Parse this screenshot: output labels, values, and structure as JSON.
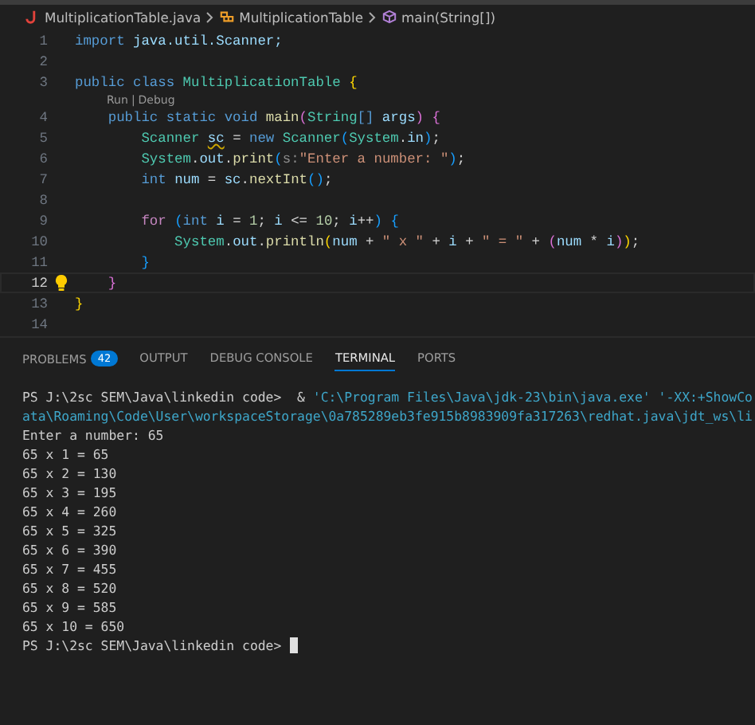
{
  "breadcrumb": [
    {
      "kind": "file",
      "label": "MultiplicationTable.java"
    },
    {
      "kind": "class",
      "label": "MultiplicationTable"
    },
    {
      "kind": "method",
      "label": "main(String[])"
    }
  ],
  "editor": {
    "lines": [
      {
        "kind": "code",
        "number": "1",
        "current": false,
        "tokens": [
          {
            "text": "import",
            "kind": "kw"
          },
          {
            "text": " java.util.Scanner;",
            "kind": "var"
          }
        ]
      },
      {
        "kind": "code",
        "number": "2",
        "current": false
      },
      {
        "kind": "code",
        "number": "3",
        "current": false,
        "tokens": [
          {
            "text": "public class ",
            "kind": "kw"
          },
          {
            "text": "MultiplicationTable ",
            "kind": "type"
          },
          {
            "text": "{",
            "kind": "b1"
          }
        ]
      },
      {
        "kind": "codelens",
        "links": [
          "Run",
          "Debug"
        ],
        "separator": "|"
      },
      {
        "kind": "code",
        "number": "4",
        "current": false,
        "tokens": [
          {
            "text": "    public static void ",
            "kind": "kw"
          },
          {
            "text": "main",
            "kind": "func"
          },
          {
            "text": "(",
            "kind": "b2"
          },
          {
            "text": "String",
            "kind": "type"
          },
          {
            "text": "[]",
            "kind": "kw"
          },
          {
            "text": " args",
            "kind": "var"
          },
          {
            "text": ") ",
            "kind": "b2"
          },
          {
            "text": "{",
            "kind": "b2"
          }
        ]
      },
      {
        "kind": "code",
        "number": "5",
        "current": false,
        "tokens": [
          {
            "text": "        Scanner ",
            "kind": "type"
          },
          {
            "text": "sc",
            "kind": "var",
            "warning": true
          },
          {
            "text": " = ",
            "kind": "plain"
          },
          {
            "text": "new ",
            "kind": "kw"
          },
          {
            "text": "Scanner",
            "kind": "type"
          },
          {
            "text": "(",
            "kind": "b3"
          },
          {
            "text": "System",
            "kind": "type"
          },
          {
            "text": ".",
            "kind": "plain"
          },
          {
            "text": "in",
            "kind": "var"
          },
          {
            "text": ")",
            "kind": "b3"
          },
          {
            "text": ";",
            "kind": "plain"
          }
        ]
      },
      {
        "kind": "code",
        "number": "6",
        "current": false,
        "tokens": [
          {
            "text": "        System",
            "kind": "type"
          },
          {
            "text": ".",
            "kind": "plain"
          },
          {
            "text": "out",
            "kind": "var"
          },
          {
            "text": ".",
            "kind": "plain"
          },
          {
            "text": "print",
            "kind": "func"
          },
          {
            "text": "(",
            "kind": "b3"
          },
          {
            "text": "s:",
            "kind": "hint"
          },
          {
            "text": "\"Enter a number: \"",
            "kind": "string"
          },
          {
            "text": ")",
            "kind": "b3"
          },
          {
            "text": ";",
            "kind": "plain"
          }
        ]
      },
      {
        "kind": "code",
        "number": "7",
        "current": false,
        "tokens": [
          {
            "text": "        int ",
            "kind": "kw"
          },
          {
            "text": "num",
            "kind": "var"
          },
          {
            "text": " = ",
            "kind": "plain"
          },
          {
            "text": "sc",
            "kind": "var"
          },
          {
            "text": ".",
            "kind": "plain"
          },
          {
            "text": "nextInt",
            "kind": "func"
          },
          {
            "text": "()",
            "kind": "b3"
          },
          {
            "text": ";",
            "kind": "plain"
          }
        ]
      },
      {
        "kind": "code",
        "number": "8",
        "current": false
      },
      {
        "kind": "code",
        "number": "9",
        "current": false,
        "tokens": [
          {
            "text": "        for ",
            "kind": "ctrl"
          },
          {
            "text": "(",
            "kind": "b3"
          },
          {
            "text": "int ",
            "kind": "kw"
          },
          {
            "text": "i",
            "kind": "var"
          },
          {
            "text": " = ",
            "kind": "plain"
          },
          {
            "text": "1",
            "kind": "num"
          },
          {
            "text": "; ",
            "kind": "plain"
          },
          {
            "text": "i",
            "kind": "var"
          },
          {
            "text": " <= ",
            "kind": "plain"
          },
          {
            "text": "10",
            "kind": "num"
          },
          {
            "text": "; ",
            "kind": "plain"
          },
          {
            "text": "i",
            "kind": "var"
          },
          {
            "text": "++",
            "kind": "plain"
          },
          {
            "text": ") ",
            "kind": "b3"
          },
          {
            "text": "{",
            "kind": "b3"
          }
        ]
      },
      {
        "kind": "code",
        "number": "10",
        "current": false,
        "tokens": [
          {
            "text": "            System",
            "kind": "type"
          },
          {
            "text": ".",
            "kind": "plain"
          },
          {
            "text": "out",
            "kind": "var"
          },
          {
            "text": ".",
            "kind": "plain"
          },
          {
            "text": "println",
            "kind": "func"
          },
          {
            "text": "(",
            "kind": "b1"
          },
          {
            "text": "num",
            "kind": "var"
          },
          {
            "text": " + ",
            "kind": "plain"
          },
          {
            "text": "\" x \"",
            "kind": "string"
          },
          {
            "text": " + ",
            "kind": "plain"
          },
          {
            "text": "i",
            "kind": "var"
          },
          {
            "text": " + ",
            "kind": "plain"
          },
          {
            "text": "\" = \"",
            "kind": "string"
          },
          {
            "text": " + ",
            "kind": "plain"
          },
          {
            "text": "(",
            "kind": "b2"
          },
          {
            "text": "num",
            "kind": "var"
          },
          {
            "text": " * ",
            "kind": "plain"
          },
          {
            "text": "i",
            "kind": "var"
          },
          {
            "text": ")",
            "kind": "b2"
          },
          {
            "text": ")",
            "kind": "b1"
          },
          {
            "text": ";",
            "kind": "plain"
          }
        ]
      },
      {
        "kind": "code",
        "number": "11",
        "current": false,
        "tokens": [
          {
            "text": "        }",
            "kind": "b3"
          }
        ]
      },
      {
        "kind": "code",
        "number": "12",
        "current": true,
        "lightbulb": true,
        "tokens": [
          {
            "text": "    }",
            "kind": "b2"
          }
        ]
      },
      {
        "kind": "code",
        "number": "13",
        "current": false,
        "tokens": [
          {
            "text": "}",
            "kind": "b1"
          }
        ]
      },
      {
        "kind": "code",
        "number": "14",
        "current": false
      }
    ]
  },
  "panel": {
    "tabs": [
      {
        "label": "PROBLEMS",
        "badge": "42",
        "selected": false
      },
      {
        "label": "OUTPUT",
        "selected": false
      },
      {
        "label": "DEBUG CONSOLE",
        "selected": false
      },
      {
        "label": "TERMINAL",
        "selected": true
      },
      {
        "label": "PORTS",
        "selected": false
      }
    ],
    "terminal": [
      {
        "segments": [
          {
            "text": "PS J:\\2sc SEM\\Java\\linkedin code>  & ",
            "kind": "plain"
          },
          {
            "text": "'C:\\Program Files\\Java\\jdk-23\\bin\\java.exe' '-XX:+ShowCo",
            "kind": "path"
          }
        ]
      },
      {
        "segments": [
          {
            "text": "ata\\Roaming\\Code\\User\\workspaceStorage\\0a785289eb3fe915b8983909fa317263\\redhat.java\\jdt_ws\\li",
            "kind": "path"
          }
        ]
      },
      {
        "segments": [
          {
            "text": "Enter a number: 65",
            "kind": "plain"
          }
        ]
      },
      {
        "segments": [
          {
            "text": "65 x 1 = 65",
            "kind": "plain"
          }
        ]
      },
      {
        "segments": [
          {
            "text": "65 x 2 = 130",
            "kind": "plain"
          }
        ]
      },
      {
        "segments": [
          {
            "text": "65 x 3 = 195",
            "kind": "plain"
          }
        ]
      },
      {
        "segments": [
          {
            "text": "65 x 4 = 260",
            "kind": "plain"
          }
        ]
      },
      {
        "segments": [
          {
            "text": "65 x 5 = 325",
            "kind": "plain"
          }
        ]
      },
      {
        "segments": [
          {
            "text": "65 x 6 = 390",
            "kind": "plain"
          }
        ]
      },
      {
        "segments": [
          {
            "text": "65 x 7 = 455",
            "kind": "plain"
          }
        ]
      },
      {
        "segments": [
          {
            "text": "65 x 8 = 520",
            "kind": "plain"
          }
        ]
      },
      {
        "segments": [
          {
            "text": "65 x 9 = 585",
            "kind": "plain"
          }
        ]
      },
      {
        "segments": [
          {
            "text": "65 x 10 = 650",
            "kind": "plain"
          }
        ]
      },
      {
        "segments": [
          {
            "text": "PS J:\\2sc SEM\\Java\\linkedin code>",
            "kind": "plain"
          }
        ],
        "cursor": true
      }
    ]
  }
}
